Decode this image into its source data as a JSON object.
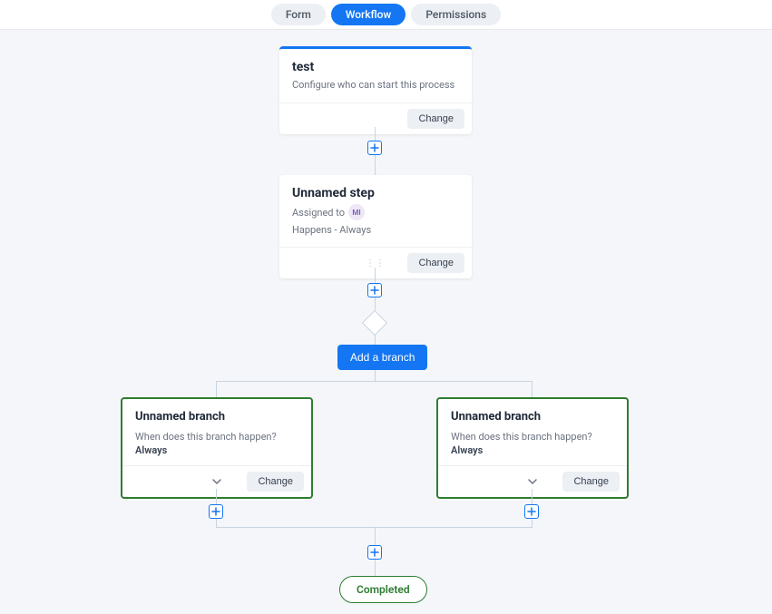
{
  "tabs": {
    "form": "Form",
    "workflow": "Workflow",
    "permissions": "Permissions"
  },
  "start_card": {
    "title": "test",
    "subtitle": "Configure who can start this process",
    "change": "Change"
  },
  "step_card": {
    "title": "Unnamed step",
    "assigned_label": "Assigned to",
    "avatar": "MI",
    "happens": "Happens - Always",
    "change": "Change"
  },
  "add_branch": "Add a branch",
  "branch_left": {
    "title": "Unnamed branch",
    "question": "When does this branch happen?",
    "answer": "Always",
    "change": "Change"
  },
  "branch_right": {
    "title": "Unnamed branch",
    "question": "When does this branch happen?",
    "answer": "Always",
    "change": "Change"
  },
  "completed": "Completed"
}
